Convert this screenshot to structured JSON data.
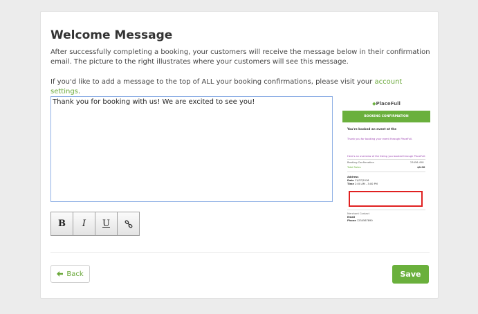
{
  "page": {
    "title": "Welcome Message",
    "intro": "After successfully completing a booking, your customers will receive the message below in their confirmation email. The picture to the right illustrates where your customers will see this message.",
    "intro2_prefix": "If you'd like to add a message to the top of ALL your booking confirmations, please visit your ",
    "intro2_link": "account settings",
    "intro2_suffix": "."
  },
  "editor": {
    "message": "Thank you for booking with us! We are excited to see you!"
  },
  "toolbar": {
    "bold_label": "B",
    "italic_label": "I",
    "underline_label": "U",
    "link_icon": "link-icon"
  },
  "preview": {
    "logo": "PlaceFull",
    "banner": "BOOKING CONFIRMATION",
    "heading": "You're booked an event at the",
    "purple1": "Thank you for booking your event through PlaceFull.",
    "purple2": "Here's an overview of the listing you booked through PlaceFull:",
    "row1_left": "Booking Confirmation",
    "row1_right": "23456-458",
    "row2_left": "Total Rates",
    "row2_right": "$0.00",
    "address_label": "Address",
    "date_label": "Date",
    "date_value": "11/07/2016",
    "time_label": "Time",
    "time_value": "2:00 AM - 3:00 PM",
    "merchant": "Merchant Contact",
    "email_label": "Email",
    "phone_label": "Phone",
    "phone_value": "1234567890"
  },
  "footer": {
    "back_label": "Back",
    "save_label": "Save"
  },
  "colors": {
    "accent": "#6ab03c",
    "link": "#6aa83a",
    "highlight": "#e02020"
  }
}
